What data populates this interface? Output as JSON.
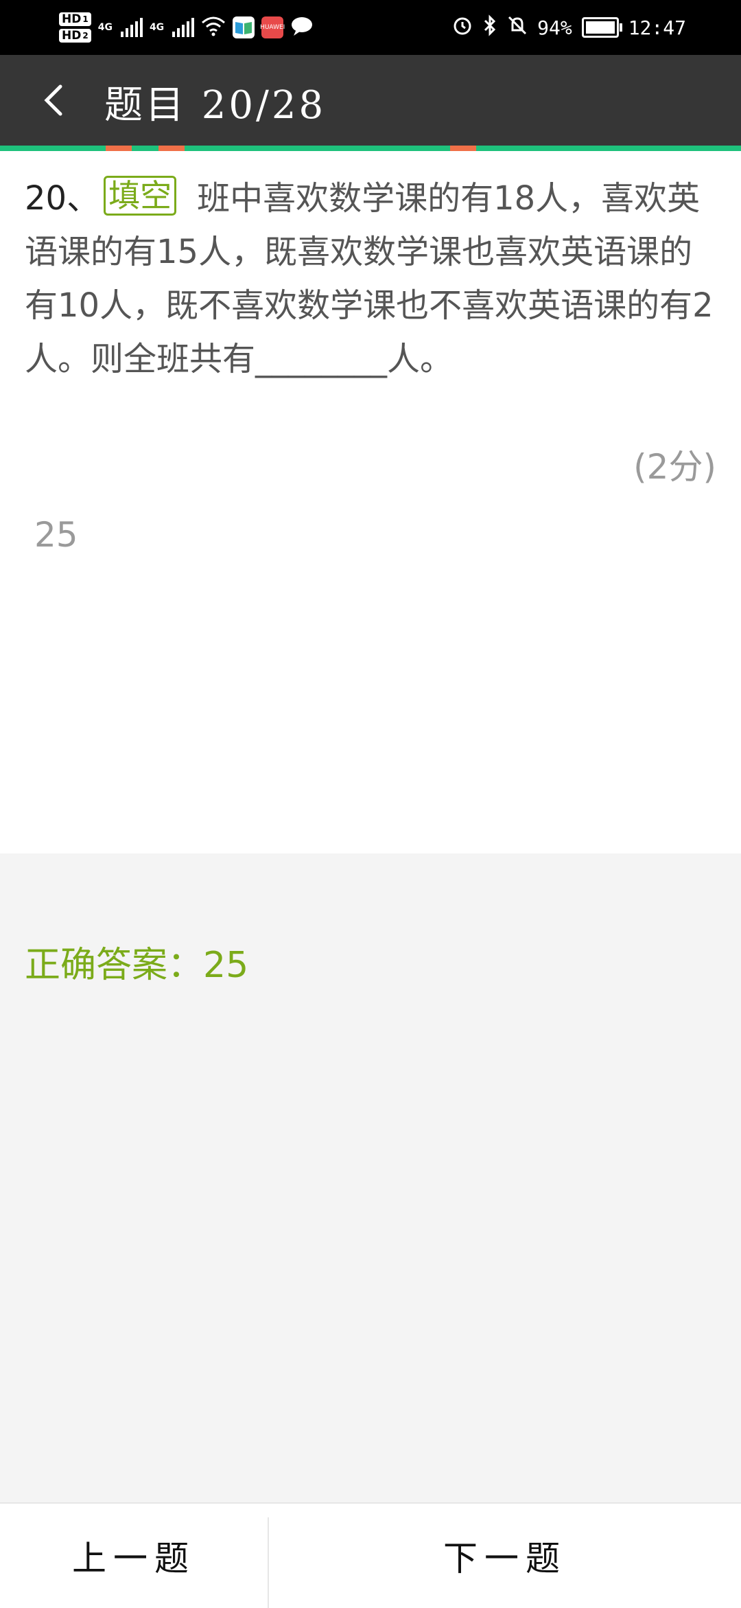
{
  "status_bar": {
    "hd1": "HD",
    "hd1_sub": "1",
    "hd2": "HD",
    "hd2_sub": "2",
    "net1": "4G",
    "net2": "4G",
    "battery": "94%",
    "time": "12:47",
    "app_badge_label": "HUAWEI"
  },
  "header": {
    "title": "题目 20/28"
  },
  "question": {
    "number": "20、",
    "type_tag": "填空",
    "text": "班中喜欢数学课的有18人，喜欢英语课的有15人，既喜欢数学课也喜欢英语课的有10人，既不喜欢数学课也不喜欢英语课的有2人。则全班共有________人。",
    "score": "(2分)",
    "user_answer": "25"
  },
  "answer": {
    "label": "正确答案：",
    "value": "25"
  },
  "nav": {
    "prev_label": "上一题",
    "next_label": "下一题"
  },
  "colors": {
    "header_bg": "#363636",
    "progress": "#1ec17c",
    "progress_mark": "#f07048",
    "accent_green": "#7bab1a"
  }
}
